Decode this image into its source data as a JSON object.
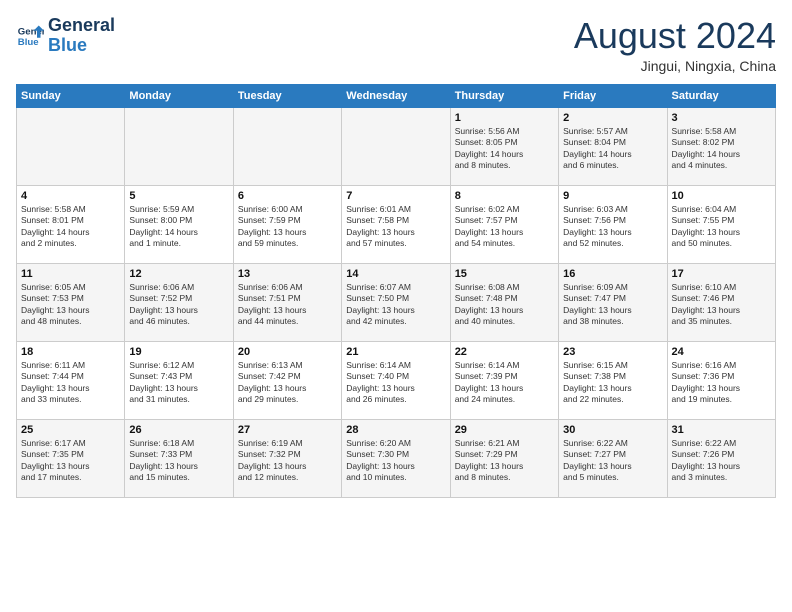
{
  "header": {
    "logo_line1": "General",
    "logo_line2": "Blue",
    "month": "August 2024",
    "location": "Jingui, Ningxia, China"
  },
  "weekdays": [
    "Sunday",
    "Monday",
    "Tuesday",
    "Wednesday",
    "Thursday",
    "Friday",
    "Saturday"
  ],
  "weeks": [
    [
      {
        "day": "",
        "info": ""
      },
      {
        "day": "",
        "info": ""
      },
      {
        "day": "",
        "info": ""
      },
      {
        "day": "",
        "info": ""
      },
      {
        "day": "1",
        "info": "Sunrise: 5:56 AM\nSunset: 8:05 PM\nDaylight: 14 hours\nand 8 minutes."
      },
      {
        "day": "2",
        "info": "Sunrise: 5:57 AM\nSunset: 8:04 PM\nDaylight: 14 hours\nand 6 minutes."
      },
      {
        "day": "3",
        "info": "Sunrise: 5:58 AM\nSunset: 8:02 PM\nDaylight: 14 hours\nand 4 minutes."
      }
    ],
    [
      {
        "day": "4",
        "info": "Sunrise: 5:58 AM\nSunset: 8:01 PM\nDaylight: 14 hours\nand 2 minutes."
      },
      {
        "day": "5",
        "info": "Sunrise: 5:59 AM\nSunset: 8:00 PM\nDaylight: 14 hours\nand 1 minute."
      },
      {
        "day": "6",
        "info": "Sunrise: 6:00 AM\nSunset: 7:59 PM\nDaylight: 13 hours\nand 59 minutes."
      },
      {
        "day": "7",
        "info": "Sunrise: 6:01 AM\nSunset: 7:58 PM\nDaylight: 13 hours\nand 57 minutes."
      },
      {
        "day": "8",
        "info": "Sunrise: 6:02 AM\nSunset: 7:57 PM\nDaylight: 13 hours\nand 54 minutes."
      },
      {
        "day": "9",
        "info": "Sunrise: 6:03 AM\nSunset: 7:56 PM\nDaylight: 13 hours\nand 52 minutes."
      },
      {
        "day": "10",
        "info": "Sunrise: 6:04 AM\nSunset: 7:55 PM\nDaylight: 13 hours\nand 50 minutes."
      }
    ],
    [
      {
        "day": "11",
        "info": "Sunrise: 6:05 AM\nSunset: 7:53 PM\nDaylight: 13 hours\nand 48 minutes."
      },
      {
        "day": "12",
        "info": "Sunrise: 6:06 AM\nSunset: 7:52 PM\nDaylight: 13 hours\nand 46 minutes."
      },
      {
        "day": "13",
        "info": "Sunrise: 6:06 AM\nSunset: 7:51 PM\nDaylight: 13 hours\nand 44 minutes."
      },
      {
        "day": "14",
        "info": "Sunrise: 6:07 AM\nSunset: 7:50 PM\nDaylight: 13 hours\nand 42 minutes."
      },
      {
        "day": "15",
        "info": "Sunrise: 6:08 AM\nSunset: 7:48 PM\nDaylight: 13 hours\nand 40 minutes."
      },
      {
        "day": "16",
        "info": "Sunrise: 6:09 AM\nSunset: 7:47 PM\nDaylight: 13 hours\nand 38 minutes."
      },
      {
        "day": "17",
        "info": "Sunrise: 6:10 AM\nSunset: 7:46 PM\nDaylight: 13 hours\nand 35 minutes."
      }
    ],
    [
      {
        "day": "18",
        "info": "Sunrise: 6:11 AM\nSunset: 7:44 PM\nDaylight: 13 hours\nand 33 minutes."
      },
      {
        "day": "19",
        "info": "Sunrise: 6:12 AM\nSunset: 7:43 PM\nDaylight: 13 hours\nand 31 minutes."
      },
      {
        "day": "20",
        "info": "Sunrise: 6:13 AM\nSunset: 7:42 PM\nDaylight: 13 hours\nand 29 minutes."
      },
      {
        "day": "21",
        "info": "Sunrise: 6:14 AM\nSunset: 7:40 PM\nDaylight: 13 hours\nand 26 minutes."
      },
      {
        "day": "22",
        "info": "Sunrise: 6:14 AM\nSunset: 7:39 PM\nDaylight: 13 hours\nand 24 minutes."
      },
      {
        "day": "23",
        "info": "Sunrise: 6:15 AM\nSunset: 7:38 PM\nDaylight: 13 hours\nand 22 minutes."
      },
      {
        "day": "24",
        "info": "Sunrise: 6:16 AM\nSunset: 7:36 PM\nDaylight: 13 hours\nand 19 minutes."
      }
    ],
    [
      {
        "day": "25",
        "info": "Sunrise: 6:17 AM\nSunset: 7:35 PM\nDaylight: 13 hours\nand 17 minutes."
      },
      {
        "day": "26",
        "info": "Sunrise: 6:18 AM\nSunset: 7:33 PM\nDaylight: 13 hours\nand 15 minutes."
      },
      {
        "day": "27",
        "info": "Sunrise: 6:19 AM\nSunset: 7:32 PM\nDaylight: 13 hours\nand 12 minutes."
      },
      {
        "day": "28",
        "info": "Sunrise: 6:20 AM\nSunset: 7:30 PM\nDaylight: 13 hours\nand 10 minutes."
      },
      {
        "day": "29",
        "info": "Sunrise: 6:21 AM\nSunset: 7:29 PM\nDaylight: 13 hours\nand 8 minutes."
      },
      {
        "day": "30",
        "info": "Sunrise: 6:22 AM\nSunset: 7:27 PM\nDaylight: 13 hours\nand 5 minutes."
      },
      {
        "day": "31",
        "info": "Sunrise: 6:22 AM\nSunset: 7:26 PM\nDaylight: 13 hours\nand 3 minutes."
      }
    ]
  ]
}
